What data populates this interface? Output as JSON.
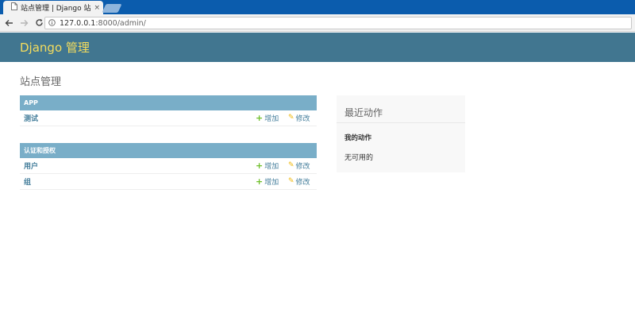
{
  "browser": {
    "tab_title": "站点管理 | Django 站点",
    "tab_close": "×",
    "url_host": "127.0.0.1",
    "url_path": ":8000/admin/"
  },
  "header": {
    "brand": "Django 管理"
  },
  "page": {
    "title": "站点管理"
  },
  "modules": [
    {
      "caption": "APP",
      "models": [
        {
          "name": "测试",
          "add": "增加",
          "change": "修改"
        }
      ]
    },
    {
      "caption": "认证和授权",
      "models": [
        {
          "name": "用户",
          "add": "增加",
          "change": "修改"
        },
        {
          "name": "组",
          "add": "增加",
          "change": "修改"
        }
      ]
    }
  ],
  "recent_actions": {
    "title": "最近动作",
    "my_actions": "我的动作",
    "none": "无可用的"
  },
  "colors": {
    "header_bg": "#417690",
    "brand": "#f5dd5d",
    "caption_bg": "#79aec8",
    "link": "#447e9b",
    "add_icon": "#70bf2b",
    "change_icon": "#efb80b"
  },
  "icons": [
    "page-icon",
    "back-arrow-icon",
    "forward-arrow-icon",
    "reload-icon",
    "info-icon",
    "plus-icon",
    "pencil-icon"
  ]
}
